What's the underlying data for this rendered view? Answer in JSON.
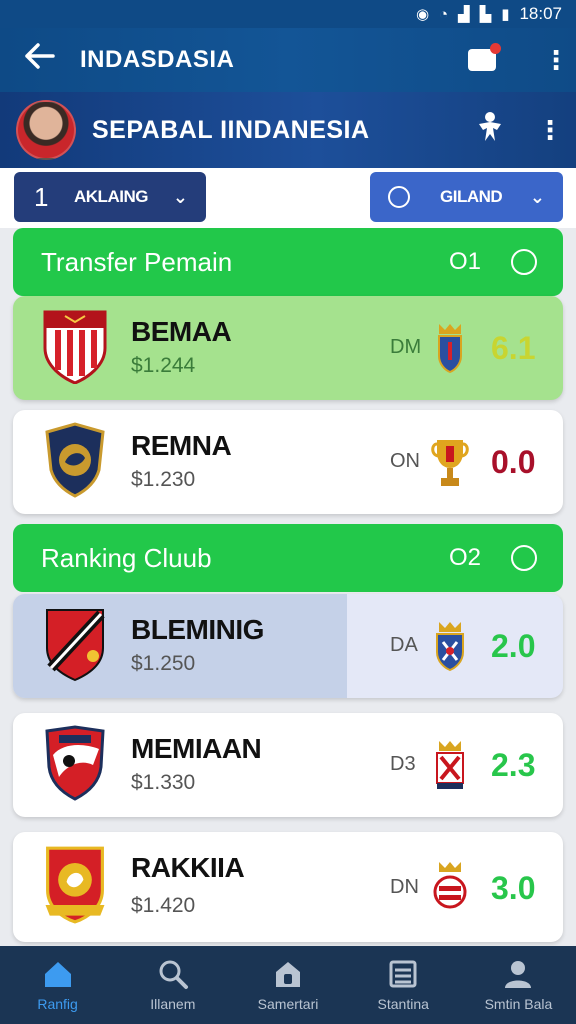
{
  "status_bar": {
    "time": "18:07",
    "icons": [
      "nfc-icon",
      "alarm-icon",
      "signal-icon",
      "wifi-icon",
      "battery-icon"
    ]
  },
  "app_bar": {
    "title": "INDASDASIA",
    "icons": [
      "back-arrow-icon",
      "chat-icon",
      "more-vert-icon"
    ]
  },
  "banner": {
    "title": "SEPABAL IINDANESIA",
    "icons": [
      "player-avatar",
      "soccer-player-icon",
      "more-vert-icon"
    ]
  },
  "filters": {
    "left": {
      "number": "1",
      "label": "AKLAING"
    },
    "right": {
      "label": "GILAND"
    }
  },
  "sections": [
    {
      "label": "Transfer Pemain",
      "count": "O1"
    },
    {
      "label": "Ranking Cluub",
      "count": "O2"
    }
  ],
  "transfer_items": [
    {
      "name": "BEMAA",
      "price": "$1.244",
      "code": "DM",
      "score": "6.1",
      "score_color": "#c8d531",
      "style": "green"
    },
    {
      "name": "REMNA",
      "price": "$1.230",
      "code": "ON",
      "score": "0.0",
      "score_color": "#a8102a",
      "style": "white"
    }
  ],
  "ranking_items": [
    {
      "name": "BLEMINIG",
      "price": "$1.250",
      "code": "DA",
      "score": "2.0",
      "score_color": "#28c64b",
      "style": "selected"
    },
    {
      "name": "MEMIAAN",
      "price": "$1.330",
      "code": "D3",
      "score": "2.3",
      "score_color": "#28c64b",
      "style": "white"
    },
    {
      "name": "RAKKIIA",
      "price": "$1.420",
      "code": "DN",
      "score": "3.0",
      "score_color": "#28c64b",
      "style": "white"
    }
  ],
  "bottom_nav": [
    {
      "label": "Ranfig",
      "icon": "home-icon",
      "active": true
    },
    {
      "label": "Illanem",
      "icon": "search-icon",
      "active": false
    },
    {
      "label": "Samertari",
      "icon": "lock-icon",
      "active": false
    },
    {
      "label": "Stantina",
      "icon": "list-icon",
      "active": false
    },
    {
      "label": "Smtin Bala",
      "icon": "profile-icon",
      "active": false
    }
  ],
  "colors": {
    "primary": "#0f4a86",
    "section_green": "#22c84a",
    "nav_bg": "#1b3554",
    "nav_active": "#3d9bf0"
  }
}
